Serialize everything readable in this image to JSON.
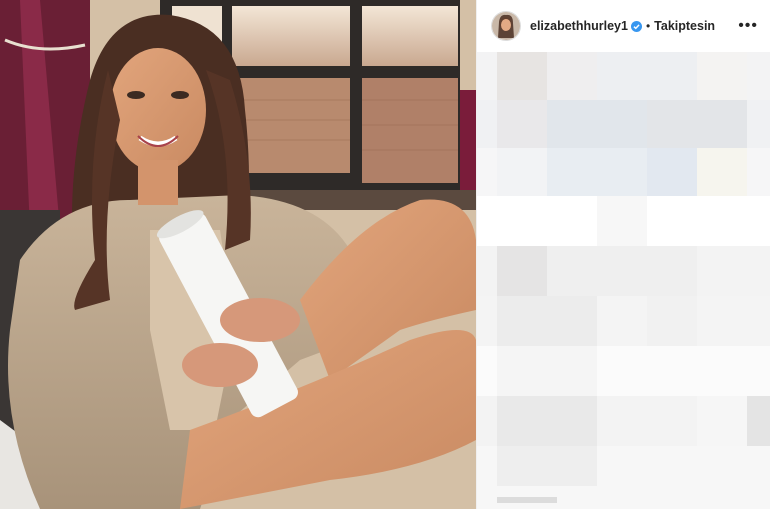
{
  "header": {
    "username": "elizabethhurley1",
    "separator": "•",
    "follow_status": "Takiptesin",
    "more_icon": "•••"
  },
  "icons": {
    "verified": "verified-badge-icon",
    "more": "more-options-icon"
  },
  "colors": {
    "verified_blue": "#3897f0",
    "text": "#262626",
    "border": "#efefef"
  }
}
